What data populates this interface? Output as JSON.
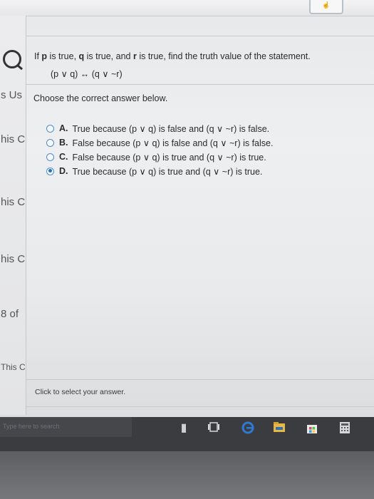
{
  "sidebar": {
    "items": [
      {
        "label": "s Us"
      },
      {
        "label": "his C"
      },
      {
        "label": "his C"
      },
      {
        "label": "his C"
      },
      {
        "label": "8 of"
      },
      {
        "label": "This C"
      }
    ]
  },
  "question": {
    "prompt_parts": [
      "If ",
      "p",
      " is true, ",
      "q",
      " is true, and ",
      "r",
      " is true, find the truth value of the statement."
    ],
    "statement": "(p ∨ q) ↔ (q ∨ ~r)",
    "instruction": "Choose the correct answer below."
  },
  "options": [
    {
      "letter": "A.",
      "text": "True because (p ∨ q) is false and (q ∨ ~r) is false.",
      "selected": false
    },
    {
      "letter": "B.",
      "text": "False because (p ∨ q) is false and (q ∨ ~r) is false.",
      "selected": false
    },
    {
      "letter": "C.",
      "text": "False because (p ∨ q) is true and (q ∨ ~r) is true.",
      "selected": false
    },
    {
      "letter": "D.",
      "text": "True because (p ∨ q) is true and (q ∨ ~r) is true.",
      "selected": true
    }
  ],
  "footer": {
    "hint": "Click to select your answer."
  },
  "taskbar": {
    "search_placeholder": "Type here to search"
  },
  "colors": {
    "radio": "#4a8fd2",
    "taskbar": "#3b3c40",
    "edge_blue": "#2d7ad6"
  }
}
